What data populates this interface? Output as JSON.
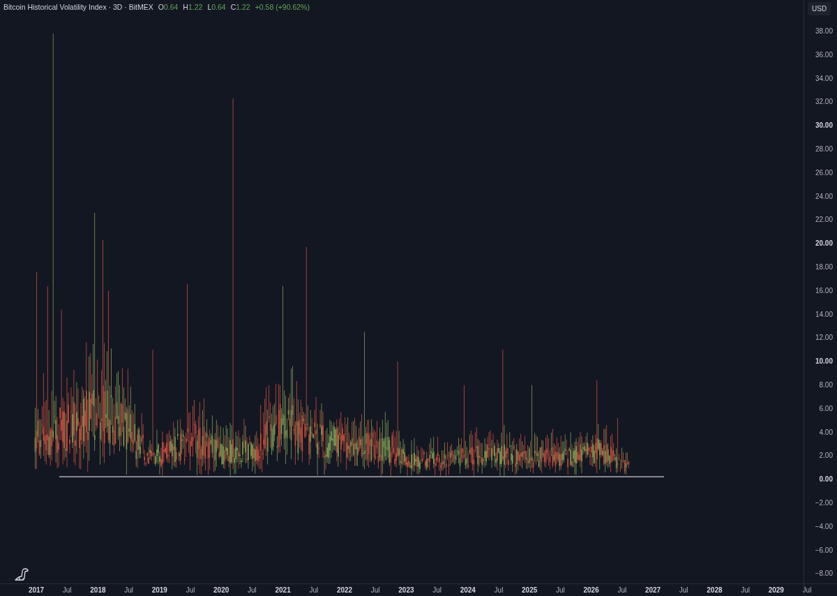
{
  "legend": {
    "title": "Bitcoin Historical Volatility Index · 3D · BitMEX",
    "ohlc": [
      {
        "label": "O",
        "value": "0.64"
      },
      {
        "label": "H",
        "value": "1.22"
      },
      {
        "label": "L",
        "value": "0.64"
      },
      {
        "label": "C",
        "value": "1.22"
      }
    ],
    "change": "+0.58 (+90.62%)"
  },
  "price_axis": {
    "currency": "USD",
    "ticks": [
      {
        "label": "38.00",
        "major": false
      },
      {
        "label": "36.00",
        "major": false
      },
      {
        "label": "34.00",
        "major": false
      },
      {
        "label": "32.00",
        "major": false
      },
      {
        "label": "30.00",
        "major": true
      },
      {
        "label": "28.00",
        "major": false
      },
      {
        "label": "26.00",
        "major": false
      },
      {
        "label": "24.00",
        "major": false
      },
      {
        "label": "22.00",
        "major": false
      },
      {
        "label": "20.00",
        "major": true
      },
      {
        "label": "18.00",
        "major": false
      },
      {
        "label": "16.00",
        "major": false
      },
      {
        "label": "14.00",
        "major": false
      },
      {
        "label": "12.00",
        "major": false
      },
      {
        "label": "10.00",
        "major": true
      },
      {
        "label": "8.00",
        "major": false
      },
      {
        "label": "6.00",
        "major": false
      },
      {
        "label": "4.00",
        "major": false
      },
      {
        "label": "2.00",
        "major": false
      },
      {
        "label": "0.00",
        "major": true
      },
      {
        "label": "−2.00",
        "major": false
      },
      {
        "label": "−4.00",
        "major": false
      },
      {
        "label": "−6.00",
        "major": false
      },
      {
        "label": "−8.00",
        "major": false
      }
    ]
  },
  "time_axis": {
    "ticks": [
      {
        "label": "2017",
        "major": true
      },
      {
        "label": "Jul",
        "major": false
      },
      {
        "label": "2018",
        "major": true
      },
      {
        "label": "Jul",
        "major": false
      },
      {
        "label": "2019",
        "major": true
      },
      {
        "label": "Jul",
        "major": false
      },
      {
        "label": "2020",
        "major": true
      },
      {
        "label": "Jul",
        "major": false
      },
      {
        "label": "2021",
        "major": true
      },
      {
        "label": "Jul",
        "major": false
      },
      {
        "label": "2022",
        "major": true
      },
      {
        "label": "Jul",
        "major": false
      },
      {
        "label": "2023",
        "major": true
      },
      {
        "label": "Jul",
        "major": false
      },
      {
        "label": "2024",
        "major": true
      },
      {
        "label": "Jul",
        "major": false
      },
      {
        "label": "2025",
        "major": true
      },
      {
        "label": "Jul",
        "major": false
      },
      {
        "label": "2026",
        "major": true
      },
      {
        "label": "Jul",
        "major": false
      },
      {
        "label": "2027",
        "major": true
      },
      {
        "label": "Jul",
        "major": false
      },
      {
        "label": "2028",
        "major": true
      },
      {
        "label": "Jul",
        "major": false
      },
      {
        "label": "2029",
        "major": true
      },
      {
        "label": "Jul",
        "major": false
      }
    ]
  }
}
